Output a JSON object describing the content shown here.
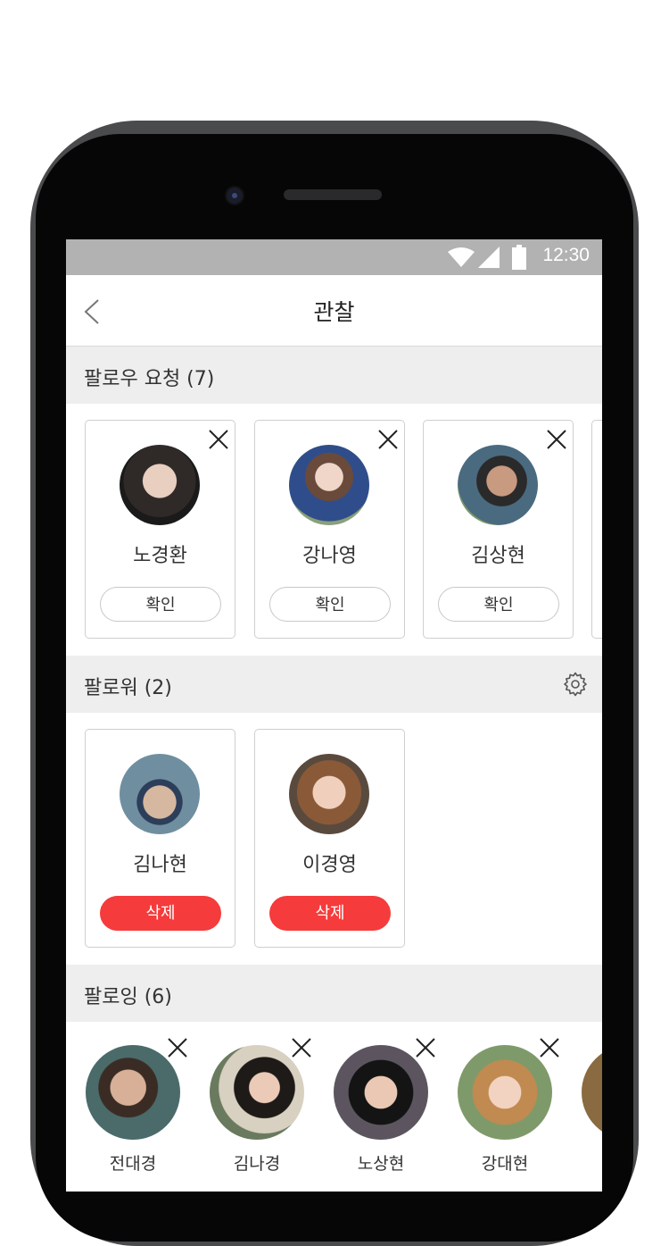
{
  "status": {
    "time": "12:30"
  },
  "header": {
    "title": "관찰"
  },
  "follow_requests": {
    "title": "팔로우 요청 (7)",
    "items": [
      {
        "name": "노경환",
        "action": "확인",
        "avatar_color": "#3a3a3a"
      },
      {
        "name": "강나영",
        "action": "확인",
        "avatar_color": "#5a7aa8"
      },
      {
        "name": "김상현",
        "action": "확인",
        "avatar_color": "#6b7d5a"
      }
    ]
  },
  "followers": {
    "title": "팔로워 (2)",
    "items": [
      {
        "name": "김나현",
        "action": "삭제",
        "avatar_color": "#3e5a6e"
      },
      {
        "name": "이경영",
        "action": "삭제",
        "avatar_color": "#7a5a48"
      }
    ]
  },
  "following": {
    "title": "팔로잉 (6)",
    "items": [
      {
        "name": "전대경",
        "avatar_color": "#4a6b6a"
      },
      {
        "name": "김나경",
        "avatar_color": "#6a7a5e"
      },
      {
        "name": "노상현",
        "avatar_color": "#5c5560"
      },
      {
        "name": "강대현",
        "avatar_color": "#7f9a6a"
      }
    ]
  },
  "colors": {
    "accent_red": "#f53b3b",
    "section_bg": "#eeeeee",
    "statusbar_bg": "#b2b2b2"
  }
}
